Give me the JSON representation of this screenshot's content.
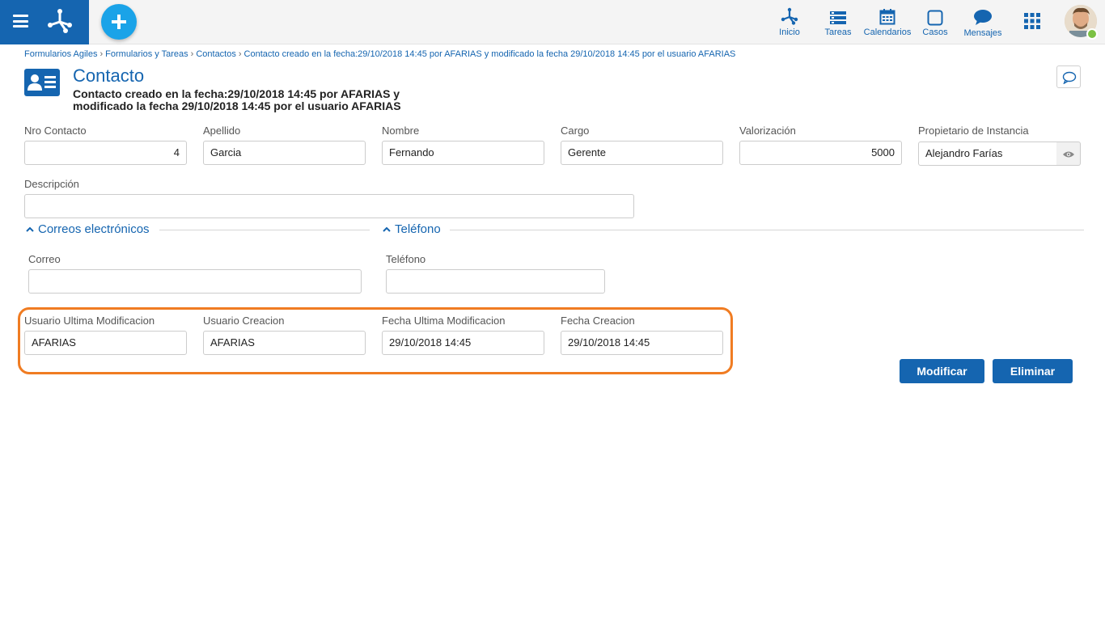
{
  "nav": {
    "items": [
      {
        "label": "Inicio"
      },
      {
        "label": "Tareas"
      },
      {
        "label": "Calendarios"
      },
      {
        "label": "Casos"
      },
      {
        "label": "Mensajes"
      }
    ]
  },
  "breadcrumb": {
    "items": [
      "Formularios Agiles",
      "Formularios y Tareas",
      "Contactos",
      "Contacto creado en la fecha:29/10/2018 14:45 por AFARIAS y modificado la fecha 29/10/2018 14:45 por el usuario AFARIAS"
    ],
    "separator": "›"
  },
  "header": {
    "title": "Contacto",
    "subtitle_line1": "Contacto creado en la fecha:29/10/2018 14:45 por AFARIAS y",
    "subtitle_line2": "modificado la fecha 29/10/2018 14:45 por el usuario AFARIAS"
  },
  "fields": {
    "nro_contacto": {
      "label": "Nro Contacto",
      "value": "4"
    },
    "apellido": {
      "label": "Apellido",
      "value": "Garcia"
    },
    "nombre": {
      "label": "Nombre",
      "value": "Fernando"
    },
    "cargo": {
      "label": "Cargo",
      "value": "Gerente"
    },
    "valorizacion": {
      "label": "Valorización",
      "value": "5000"
    },
    "propietario": {
      "label": "Propietario de Instancia",
      "value": "Alejandro Farías"
    },
    "descripcion": {
      "label": "Descripción",
      "value": ""
    }
  },
  "sections": {
    "correos": {
      "title": "Correos electrónicos",
      "field_label": "Correo",
      "value": ""
    },
    "telefono": {
      "title": "Teléfono",
      "field_label": "Teléfono",
      "value": ""
    }
  },
  "audit": {
    "usuario_ultima_mod": {
      "label": "Usuario Ultima Modificacion",
      "value": "AFARIAS"
    },
    "usuario_creacion": {
      "label": "Usuario Creacion",
      "value": "AFARIAS"
    },
    "fecha_ultima_mod": {
      "label": "Fecha Ultima Modificacion",
      "value": "29/10/2018 14:45"
    },
    "fecha_creacion": {
      "label": "Fecha Creacion",
      "value": "29/10/2018 14:45"
    }
  },
  "actions": {
    "modificar": "Modificar",
    "eliminar": "Eliminar"
  },
  "colors": {
    "primary": "#1565b0",
    "accent": "#1aa3e8",
    "highlight": "#f07c22",
    "online": "#7bc143"
  }
}
